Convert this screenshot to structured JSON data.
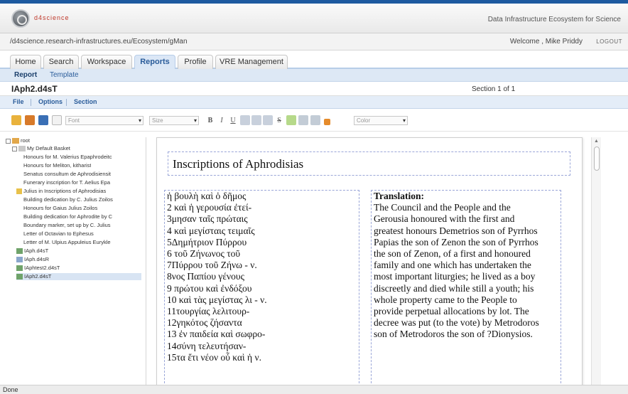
{
  "brand": {
    "logo_text": "d4science",
    "tagline": "Data Infrastructure Ecosystem for Science",
    "accent": "#1d5aa0"
  },
  "location": {
    "path": "/d4science.research-infrastructures.eu/Ecosystem/gMan",
    "welcome": "Welcome , Mike Priddy",
    "logout": "Logout"
  },
  "tabs": [
    {
      "label": "Home"
    },
    {
      "label": "Search"
    },
    {
      "label": "Workspace"
    },
    {
      "label": "Reports",
      "active": true
    },
    {
      "label": "Profile"
    },
    {
      "label": "VRE Management"
    }
  ],
  "subtabs": [
    {
      "label": "Report",
      "active": true
    },
    {
      "label": "Template"
    }
  ],
  "document": {
    "title": "IAph2.d4sT",
    "section": "Section 1 of 1"
  },
  "menu": [
    {
      "label": "File"
    },
    {
      "label": "Options"
    },
    {
      "label": "Section"
    }
  ],
  "toolbar": {
    "font_placeholder": "Font",
    "size_placeholder": "Size",
    "color_placeholder": "Color",
    "bold": "B",
    "italic": "I",
    "underline": "U",
    "strike": "S"
  },
  "tree": {
    "root": "root",
    "basket": "My Default Basket",
    "items": [
      "Honours for M. Valerius Epaphrodeitc",
      "Honours for Meliton, kitharist",
      "Senatus consultum de Aphrodisiensit",
      "Funerary inscription for T. Aelius Epa",
      "Julius in Inscriptions of Aphrodisias",
      "Building dedication by C. Julius Zoilos",
      "Honours for Gaius Julius Zoilos",
      "Building dedication for Aphrodite by C",
      "Boundary marker, set up by C. Julius",
      "Letter of Octavian to Ephesus",
      "Letter of M. Ulpius Appuleius Eurykle",
      "IAph.d4sT",
      "IAph.d4sR",
      "IAphtest2.d4sT",
      "IAph2.d4sT"
    ]
  },
  "page": {
    "heading": "Inscriptions of Aphrodisias",
    "greek_lines": [
      "ἡ βουλὴ καὶ ὁ δῆμος",
      "2 καὶ ἡ γερουσία ἐτεί-",
      "3μησαν ταῖς πρώταις",
      "4 καὶ μεγίσταις τειμαῖς",
      "5Δημήτριον Πύρρου",
      "6 τοῦ Ζήνωνος τοῦ",
      "7Πύρρου τοῦ Ζήνω - ν.",
      "8νος Παπίου γένους",
      "9 πρώτου καὶ ἐνδόξου",
      "10 καὶ τὰς μεγίστας λι - ν.",
      "11τουργίας λελιτουρ-",
      "12γηκότος ζήσαντα",
      "13 ἐν παιδεία καὶ σωφρο-",
      "14σύνη τελευτήσαν-",
      "15τα ἔτι νέον οὗ καὶ ἡ ν."
    ],
    "translation_heading": "Translation:",
    "translation_lines": [
      "The Council and the People and the",
      "Gerousia honoured with the first and",
      "greatest honours Demetrios son of Pyrrhos",
      "Papias the son of Zenon the son of Pyrrhos",
      "the son of Zenon, of a first and honoured",
      "family and one which has undertaken the",
      "most important liturgies; he lived as a boy",
      "discreetly and died while still a youth; his",
      "whole property came to the People to",
      "provide perpetual allocations by lot. The",
      "decree was put (to the vote) by Metrodoros",
      "son of Metrodoros the son of ?Dionysios."
    ]
  },
  "status": "Done"
}
